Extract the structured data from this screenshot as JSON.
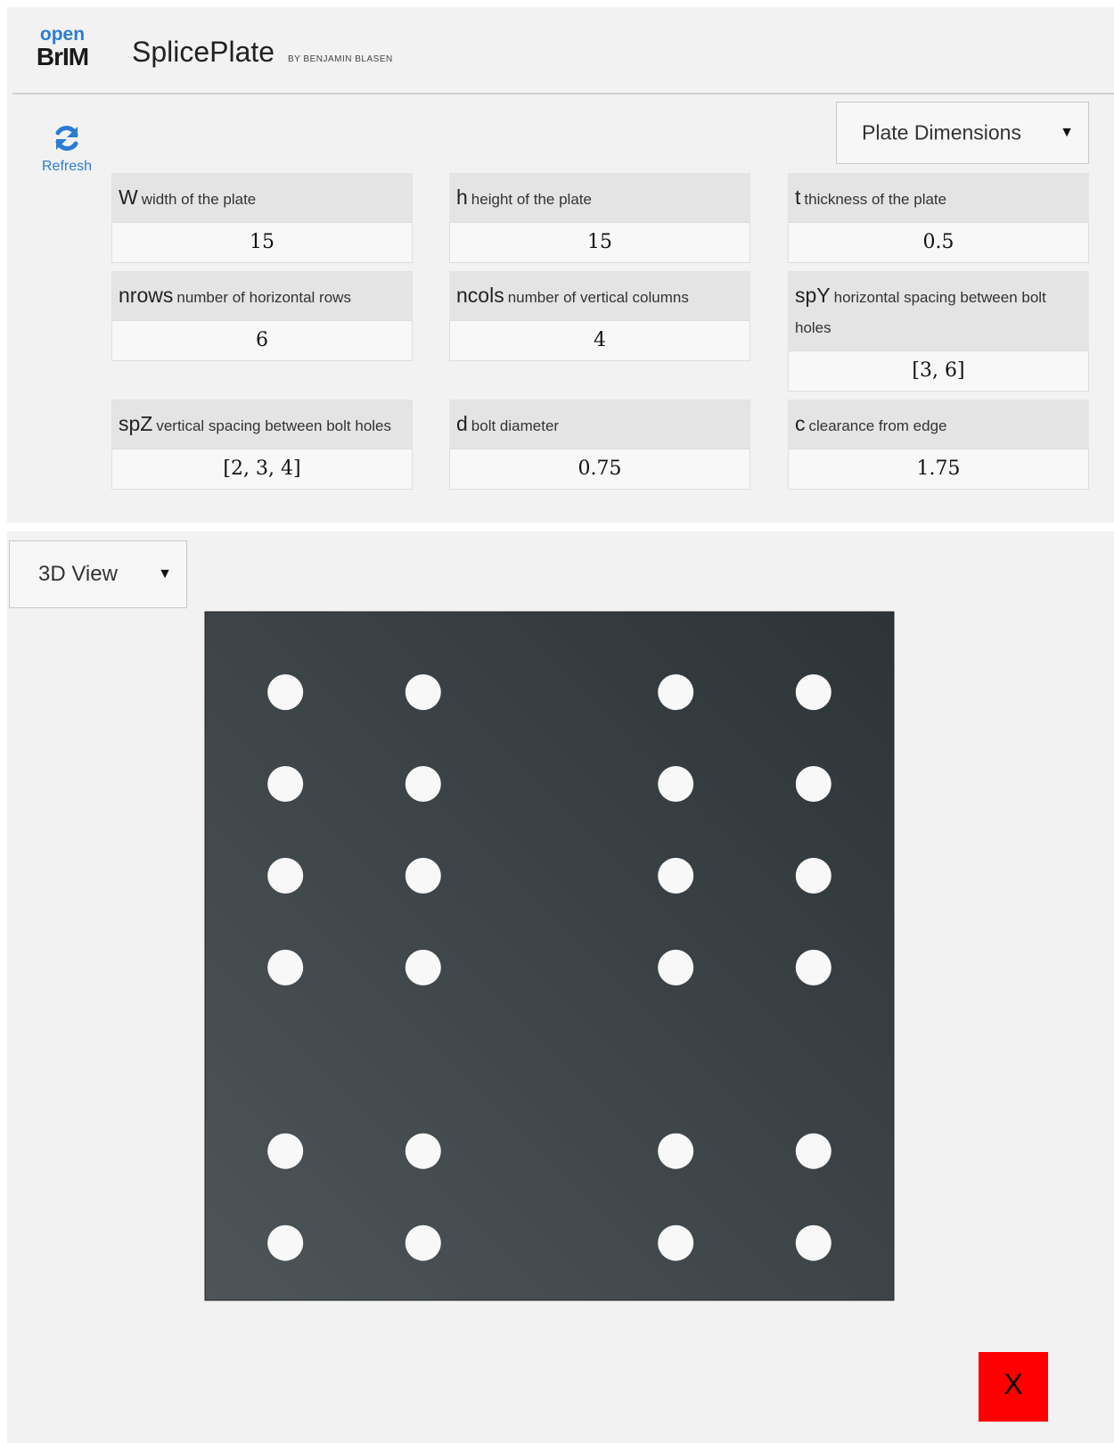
{
  "header": {
    "logo_top": "open",
    "logo_bottom": "BrIM",
    "app_name": "SplicePlate",
    "byline": "by Benjamin Blasen"
  },
  "toolbar": {
    "refresh_label": "Refresh",
    "panel_select": "Plate Dimensions",
    "view_select": "3D View"
  },
  "fields": [
    {
      "symbol": "W",
      "description": "width of the plate",
      "value": "15"
    },
    {
      "symbol": "h",
      "description": "height of the plate",
      "value": "15"
    },
    {
      "symbol": "t",
      "description": "thickness of the plate",
      "value": "0.5"
    },
    {
      "symbol": "nrows",
      "description": "number of horizontal rows",
      "value": "6"
    },
    {
      "symbol": "ncols",
      "description": "number of vertical columns",
      "value": "4"
    },
    {
      "symbol": "spY",
      "description": "horizontal spacing between bolt holes",
      "value": "[3, 6]"
    },
    {
      "symbol": "spZ",
      "description": "vertical spacing between bolt holes",
      "value": "[2, 3, 4]"
    },
    {
      "symbol": "d",
      "description": "bolt diameter",
      "value": "0.75"
    },
    {
      "symbol": "c",
      "description": "clearance from edge",
      "value": "1.75"
    }
  ],
  "plate": {
    "colors": {
      "dark": "#2c3438",
      "light": "#4d5559",
      "hole": "#f8f8f8"
    }
  },
  "close_button": {
    "label": "X",
    "color": "#ff0000"
  }
}
